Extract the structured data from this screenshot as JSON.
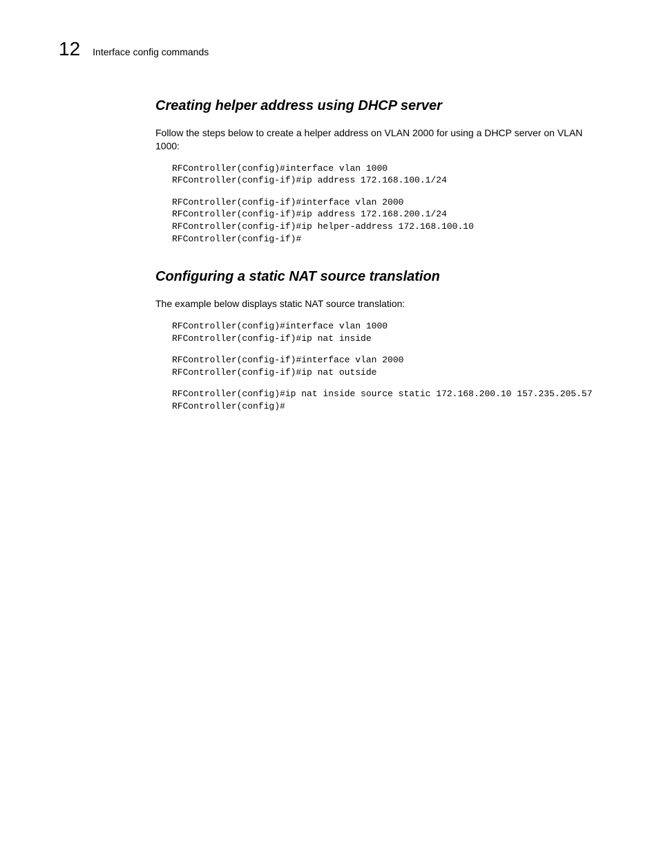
{
  "header": {
    "chapter_number": "12",
    "chapter_title": "Interface config commands"
  },
  "section1": {
    "heading": "Creating helper address using DHCP server",
    "intro": "Follow the steps below to create a helper address on VLAN 2000 for using a DHCP server   on VLAN 1000:",
    "code1": "RFController(config)#interface vlan 1000\nRFController(config-if)#ip address 172.168.100.1/24",
    "code2": "RFController(config-if)#interface vlan 2000\nRFController(config-if)#ip address 172.168.200.1/24\nRFController(config-if)#ip helper-address 172.168.100.10\nRFController(config-if)#"
  },
  "section2": {
    "heading": "Configuring a static NAT source translation",
    "intro": "The example below displays static NAT source translation:",
    "code1": "RFController(config)#interface vlan 1000\nRFController(config-if)#ip nat inside",
    "code2": "RFController(config-if)#interface vlan 2000\nRFController(config-if)#ip nat outside",
    "code3": "RFController(config)#ip nat inside source static 172.168.200.10 157.235.205.57\nRFController(config)#"
  }
}
